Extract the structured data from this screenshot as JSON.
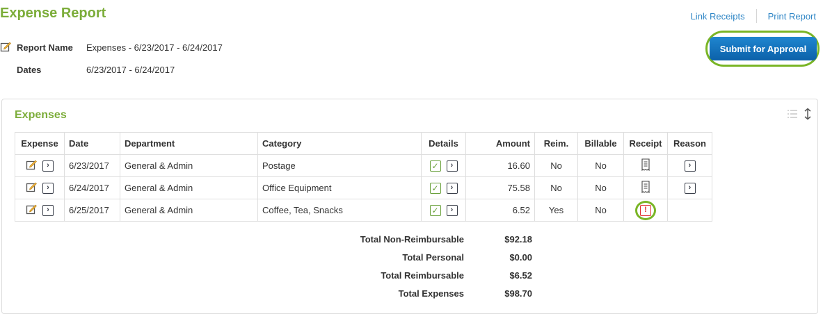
{
  "header": {
    "title": "Expense Report",
    "links": [
      "Link Receipts",
      "Print Report"
    ],
    "submit_label": "Submit for Approval"
  },
  "report": {
    "name_label": "Report Name",
    "name_value": "Expenses - 6/23/2017 - 6/24/2017",
    "dates_label": "Dates",
    "dates_value": "6/23/2017 - 6/24/2017"
  },
  "expenses": {
    "title": "Expenses",
    "columns": [
      "Expense",
      "Date",
      "Department",
      "Category",
      "Details",
      "Amount",
      "Reim.",
      "Billable",
      "Receipt",
      "Reason"
    ],
    "rows": [
      {
        "date": "6/23/2017",
        "department": "General & Admin",
        "category": "Postage",
        "amount": "16.60",
        "reim": "No",
        "billable": "No",
        "receipt": "receipt-icon",
        "reason": true
      },
      {
        "date": "6/24/2017",
        "department": "General & Admin",
        "category": "Office Equipment",
        "amount": "75.58",
        "reim": "No",
        "billable": "No",
        "receipt": "receipt-icon",
        "reason": true
      },
      {
        "date": "6/25/2017",
        "department": "General & Admin",
        "category": "Coffee, Tea, Snacks",
        "amount": "6.52",
        "reim": "Yes",
        "billable": "No",
        "receipt": "missing-receipt-warning-icon",
        "reason": false
      }
    ]
  },
  "totals": [
    {
      "label": "Total Non-Reimbursable",
      "value": "$92.18"
    },
    {
      "label": "Total Personal",
      "value": "$0.00"
    },
    {
      "label": "Total Reimbursable",
      "value": "$6.52"
    },
    {
      "label": "Total Expenses",
      "value": "$98.70"
    }
  ],
  "colors": {
    "brand_green": "#7cad3a",
    "link_blue": "#2f86c6",
    "button_blue": "#0c61a9",
    "highlight_green": "#7ab526",
    "warning_red": "#e02b2b"
  }
}
